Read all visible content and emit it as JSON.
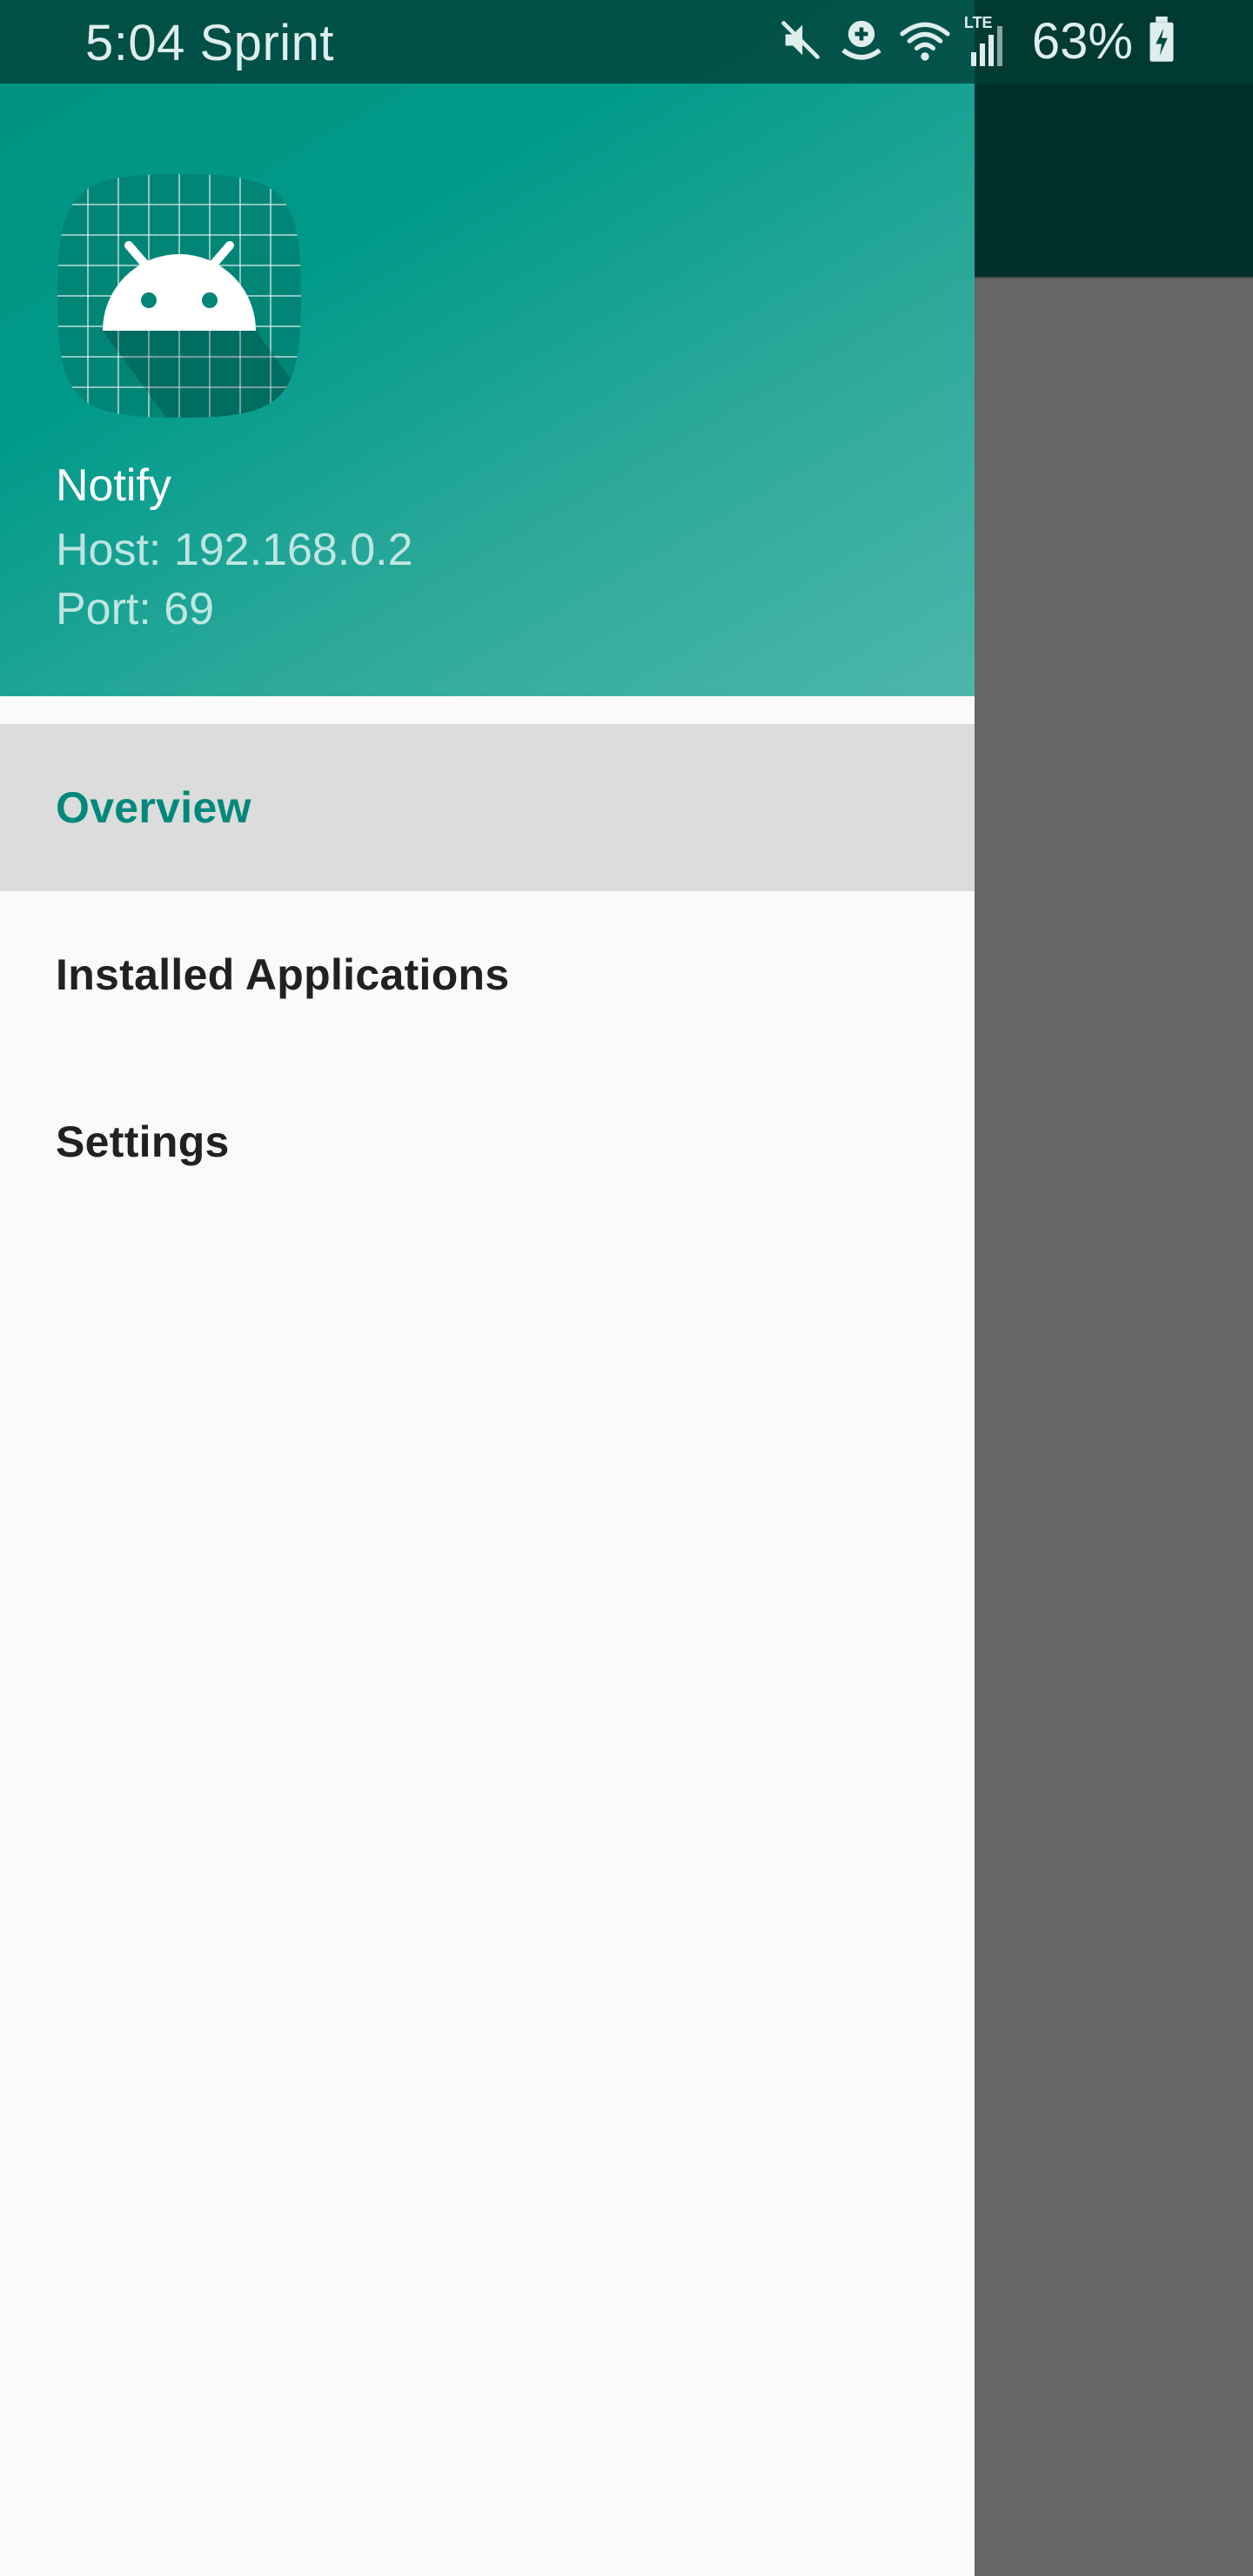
{
  "status_bar": {
    "time_carrier": "5:04 Sprint",
    "network_label": "LTE",
    "battery_percent": "63%",
    "icons": [
      "mute-icon",
      "data-saver-icon",
      "wifi-icon",
      "signal-icon",
      "battery-charging-icon"
    ]
  },
  "drawer": {
    "header": {
      "app_name": "Notify",
      "host": "Host: 192.168.0.2",
      "port": "Port: 69",
      "launcher_icon": "android-icon"
    },
    "menu": [
      {
        "label": "Overview",
        "selected": true
      },
      {
        "label": "Installed Applications",
        "selected": false
      },
      {
        "label": "Settings",
        "selected": false
      }
    ]
  },
  "colors": {
    "accent": "#00897b",
    "header_gradient_start": "#00907f",
    "header_gradient_end": "#4db6ac",
    "selected_item_bg": "#dcdcdc",
    "drawer_bg": "#fafafa",
    "scrim": "#666666"
  }
}
